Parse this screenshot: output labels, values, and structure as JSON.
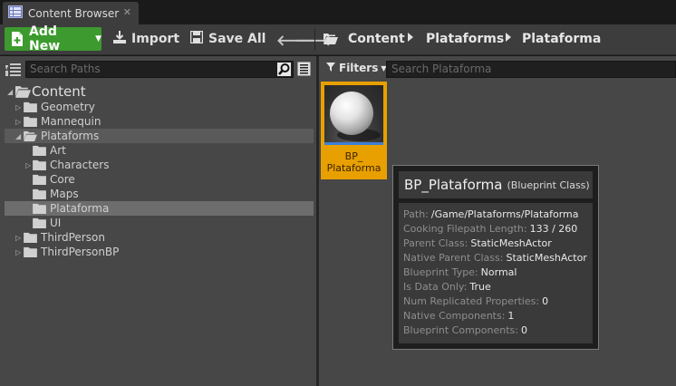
{
  "tab": {
    "title": "Content Browser",
    "close": "✕"
  },
  "toolbar": {
    "add_new": "Add New",
    "import": "Import",
    "save_all": "Save All"
  },
  "breadcrumb": [
    "Content",
    "Plataforms",
    "Plataforma"
  ],
  "paths": {
    "search_placeholder": "Search Paths",
    "tree": [
      {
        "label": "Content",
        "depth": 0,
        "expander": "◢",
        "open": true,
        "selected": false
      },
      {
        "label": "Geometry",
        "depth": 1,
        "expander": "▷",
        "open": false,
        "selected": false
      },
      {
        "label": "Mannequin",
        "depth": 1,
        "expander": "▷",
        "open": false,
        "selected": false
      },
      {
        "label": "Plataforms",
        "depth": 1,
        "expander": "◢",
        "open": true,
        "selected": false,
        "highlight": true
      },
      {
        "label": "Art",
        "depth": 2,
        "expander": "",
        "open": false,
        "selected": false
      },
      {
        "label": "Characters",
        "depth": 2,
        "expander": "▷",
        "open": false,
        "selected": false
      },
      {
        "label": "Core",
        "depth": 2,
        "expander": "",
        "open": false,
        "selected": false
      },
      {
        "label": "Maps",
        "depth": 2,
        "expander": "",
        "open": false,
        "selected": false
      },
      {
        "label": "Plataforma",
        "depth": 2,
        "expander": "",
        "open": false,
        "selected": true
      },
      {
        "label": "UI",
        "depth": 2,
        "expander": "",
        "open": false,
        "selected": false
      },
      {
        "label": "ThirdPerson",
        "depth": 1,
        "expander": "▷",
        "open": false,
        "selected": false
      },
      {
        "label": "ThirdPersonBP",
        "depth": 1,
        "expander": "▷",
        "open": false,
        "selected": false
      }
    ]
  },
  "assets": {
    "filters_label": "Filters",
    "search_placeholder": "Search Plataforma",
    "items": [
      {
        "name": "BP_\nPlataforma"
      }
    ]
  },
  "tooltip": {
    "name": "BP_Plataforma",
    "type": "(Blueprint Class)",
    "rows": [
      {
        "key": "Path:",
        "value": "/Game/Plataforms/Plataforma"
      },
      {
        "key": "Cooking Filepath Length:",
        "value": "133 / 260"
      },
      {
        "key": "Parent Class:",
        "value": "StaticMeshActor"
      },
      {
        "key": "Native Parent Class:",
        "value": "StaticMeshActor"
      },
      {
        "key": "Blueprint Type:",
        "value": "Normal"
      },
      {
        "key": "Is Data Only:",
        "value": "True"
      },
      {
        "key": "Num Replicated Properties:",
        "value": "0"
      },
      {
        "key": "Native Components:",
        "value": "1"
      },
      {
        "key": "Blueprint Components:",
        "value": "0"
      }
    ]
  },
  "colors": {
    "add_new_green": "#3c9a2e",
    "selection_orange": "#e8a000",
    "panel_gray": "#474747"
  }
}
